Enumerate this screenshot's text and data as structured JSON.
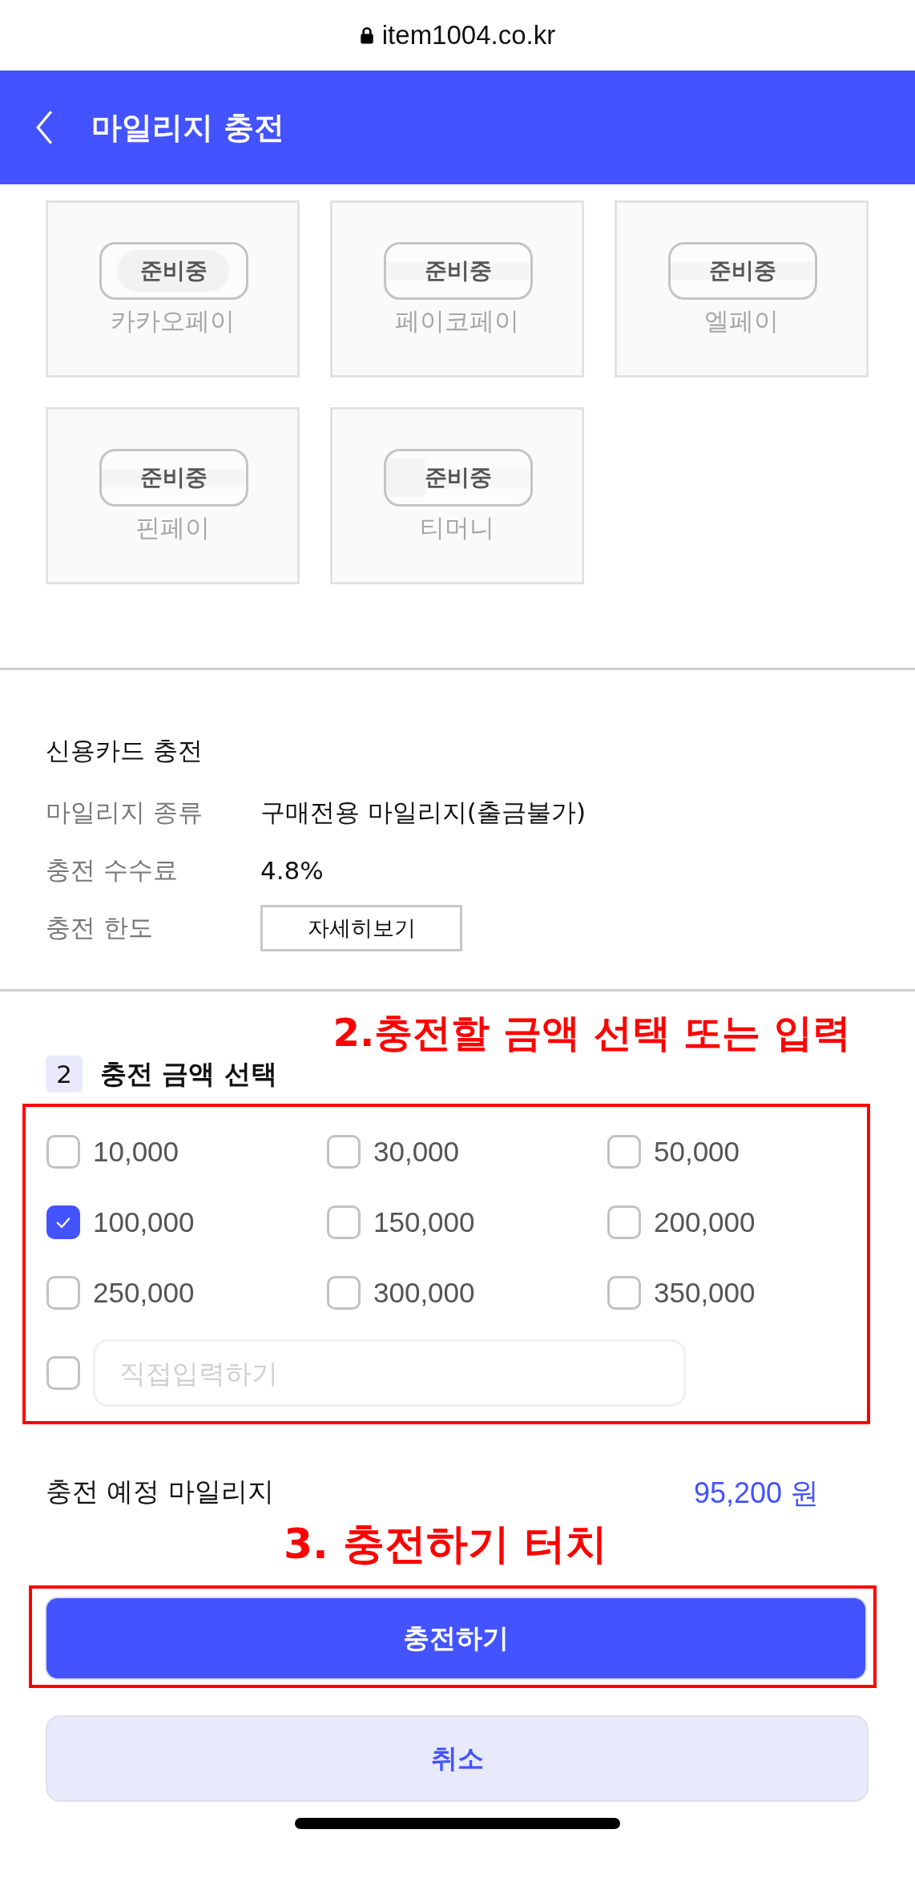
{
  "browser": {
    "url": "item1004.co.kr"
  },
  "header": {
    "title": "마일리지 충전"
  },
  "pay_methods": [
    {
      "name": "카카오페이",
      "badge": "준비중",
      "kind": "bubble"
    },
    {
      "name": "페이코페이",
      "badge": "준비중",
      "kind": "wordmark"
    },
    {
      "name": "엘페이",
      "badge": "준비중",
      "kind": "wordmark"
    },
    {
      "name": "핀페이",
      "badge": "준비중",
      "kind": "wordmark"
    },
    {
      "name": "티머니",
      "badge": "준비중",
      "kind": "square"
    }
  ],
  "card_charge": {
    "title": "신용카드 충전",
    "rows": [
      {
        "label": "마일리지 종류",
        "value": "구매전용 마일리지(출금불가)",
        "kind": "text"
      },
      {
        "label": "충전 수수료",
        "value": "4.8%",
        "kind": "text"
      },
      {
        "label": "충전 한도",
        "value": "자세히보기",
        "kind": "button"
      }
    ]
  },
  "annotation_amount": "2.충전할 금액 선택 또는 입력",
  "amount_section": {
    "step": "2",
    "title": "충전 금액 선택",
    "options": [
      {
        "label": "10,000",
        "checked": false
      },
      {
        "label": "30,000",
        "checked": false
      },
      {
        "label": "50,000",
        "checked": false
      },
      {
        "label": "100,000",
        "checked": true
      },
      {
        "label": "150,000",
        "checked": false
      },
      {
        "label": "200,000",
        "checked": false
      },
      {
        "label": "250,000",
        "checked": false
      },
      {
        "label": "300,000",
        "checked": false
      },
      {
        "label": "350,000",
        "checked": false
      }
    ],
    "custom": {
      "checked": false,
      "placeholder": "직접입력하기"
    }
  },
  "expected": {
    "label": "충전 예정 마일리지",
    "value": "95,200 원"
  },
  "annotation_button": "3. 충전하기 터치",
  "buttons": {
    "primary": "충전하기",
    "secondary": "취소"
  }
}
